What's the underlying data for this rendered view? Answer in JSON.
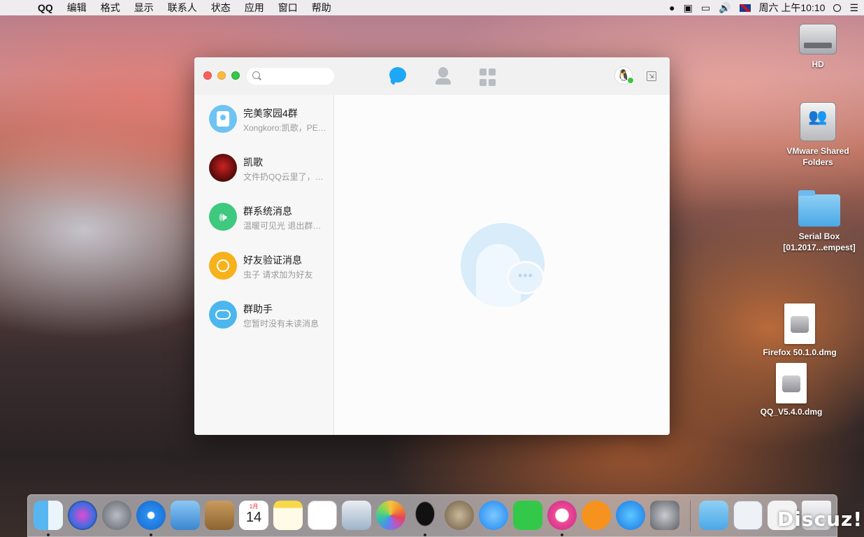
{
  "menubar": {
    "apple_icon": "apple-icon",
    "app_name": "QQ",
    "items": [
      "编辑",
      "格式",
      "显示",
      "联系人",
      "状态",
      "应用",
      "窗口",
      "帮助"
    ],
    "clock": "周六 上午10:10"
  },
  "desktop": {
    "items": [
      {
        "label": "HD",
        "icon": "hard-drive-icon"
      },
      {
        "label": "VMware Shared Folders",
        "icon": "network-share-icon"
      },
      {
        "label": "Serial Box [01.2017...empest]",
        "icon": "folder-icon"
      },
      {
        "label": "Firefox 50.1.0.dmg",
        "icon": "disk-image-icon"
      },
      {
        "label": "QQ_V5.4.0.dmg",
        "icon": "disk-image-icon"
      }
    ]
  },
  "qq": {
    "search": {
      "placeholder": "",
      "value": ""
    },
    "tabs": [
      "chat-bubble-icon",
      "contacts-icon",
      "apps-grid-icon"
    ],
    "active_tab": "chat",
    "colors": {
      "accent": "#1ea7f5",
      "online": "#3cc43c"
    },
    "conversations": [
      {
        "name": "完美家园4群",
        "preview": "Xongkoro:凯歌，PE…",
        "avatar": "group-badge-icon"
      },
      {
        "name": "凯歌",
        "preview": "文件扔QQ云里了，…",
        "avatar": "user-photo-avatar"
      },
      {
        "name": "群系统消息",
        "preview": "温暖可见光 退出群…",
        "avatar": "speaker-icon"
      },
      {
        "name": "好友验证消息",
        "preview": "虫子 请求加为好友",
        "avatar": "person-icon"
      },
      {
        "name": "群助手",
        "preview": "您暂时没有未读消息",
        "avatar": "group-assistant-icon"
      }
    ]
  },
  "dock": {
    "apps": [
      "Finder",
      "Siri",
      "Launchpad",
      "Safari",
      "Mail",
      "Contacts",
      "Calendar",
      "Notes",
      "Reminders",
      "Preview",
      "Photos",
      "QQ",
      "Skull",
      "Messages",
      "FaceTime",
      "iTunes",
      "iBooks",
      "App Store",
      "System Preferences",
      "Downloads",
      "Screenshot",
      "Document",
      "Trash"
    ],
    "calendar_month": "1月",
    "calendar_day": "14"
  },
  "watermark": "Discuz!"
}
